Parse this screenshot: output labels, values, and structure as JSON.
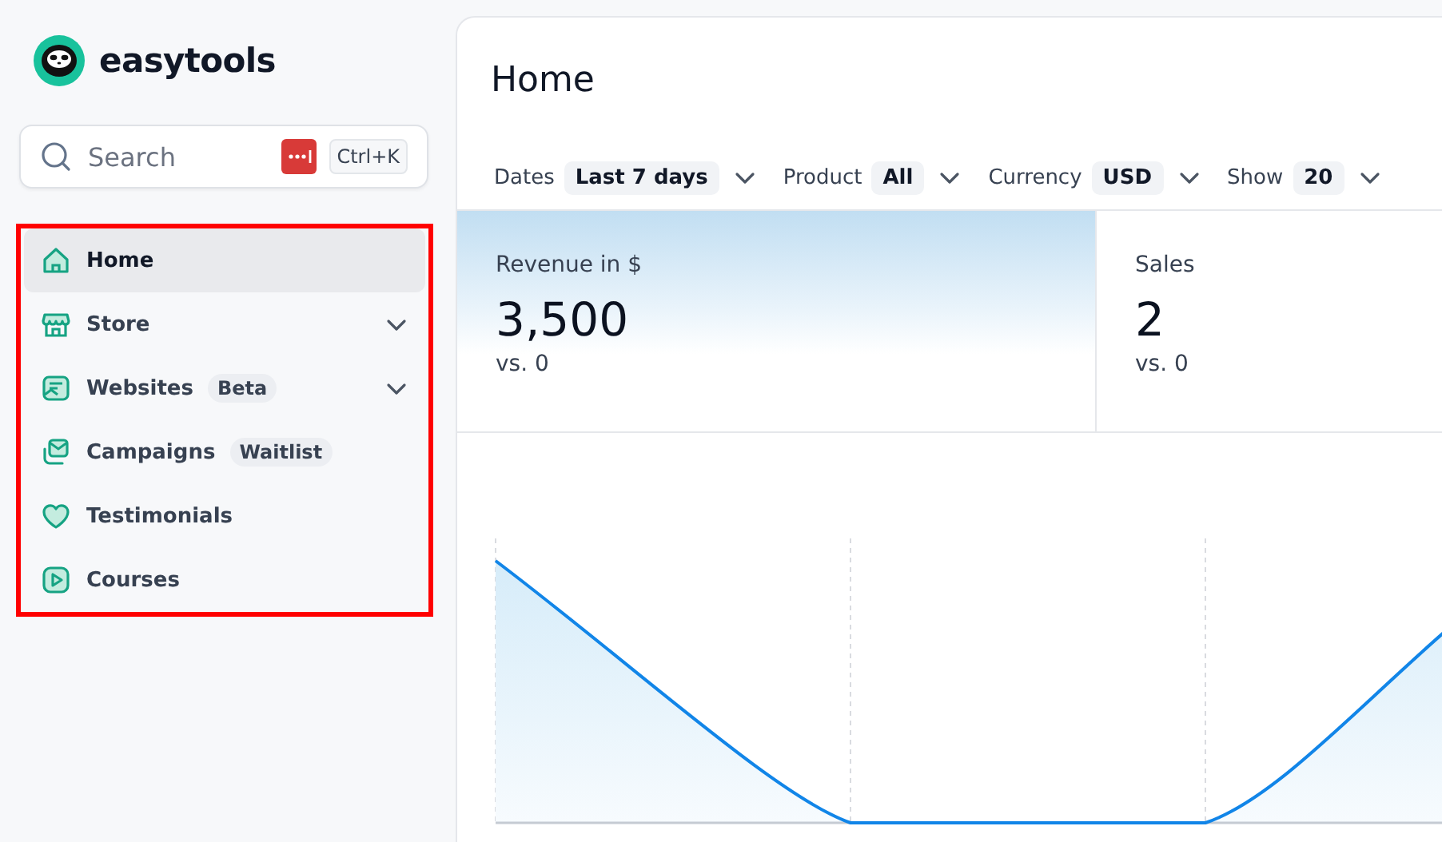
{
  "app": {
    "name": "easytools"
  },
  "search": {
    "placeholder": "Search",
    "shortcut": "Ctrl+K"
  },
  "sidebar": {
    "highlighted": true,
    "items": [
      {
        "label": "Home",
        "kind": "home",
        "selected": true
      },
      {
        "label": "Store",
        "kind": "store",
        "selected": false,
        "expanded": false
      },
      {
        "label": "Websites",
        "kind": "websites",
        "selected": false,
        "badge": "Beta",
        "expanded": false
      },
      {
        "label": "Campaigns",
        "kind": "campaigns",
        "selected": false,
        "badge": "Waitlist"
      },
      {
        "label": "Testimonials",
        "kind": "testimonials",
        "selected": false
      },
      {
        "label": "Courses",
        "kind": "courses",
        "selected": false
      }
    ]
  },
  "page": {
    "title": "Home"
  },
  "filters": [
    {
      "label": "Dates",
      "value": "Last 7 days"
    },
    {
      "label": "Product",
      "value": "All"
    },
    {
      "label": "Currency",
      "value": "USD"
    },
    {
      "label": "Show",
      "value": "20"
    }
  ],
  "stats": [
    {
      "label": "Revenue in $",
      "value": "3,500",
      "comparison": "vs. 0",
      "selected": true
    },
    {
      "label": "Sales",
      "value": "2",
      "comparison": "vs. 0",
      "selected": false
    }
  ]
}
